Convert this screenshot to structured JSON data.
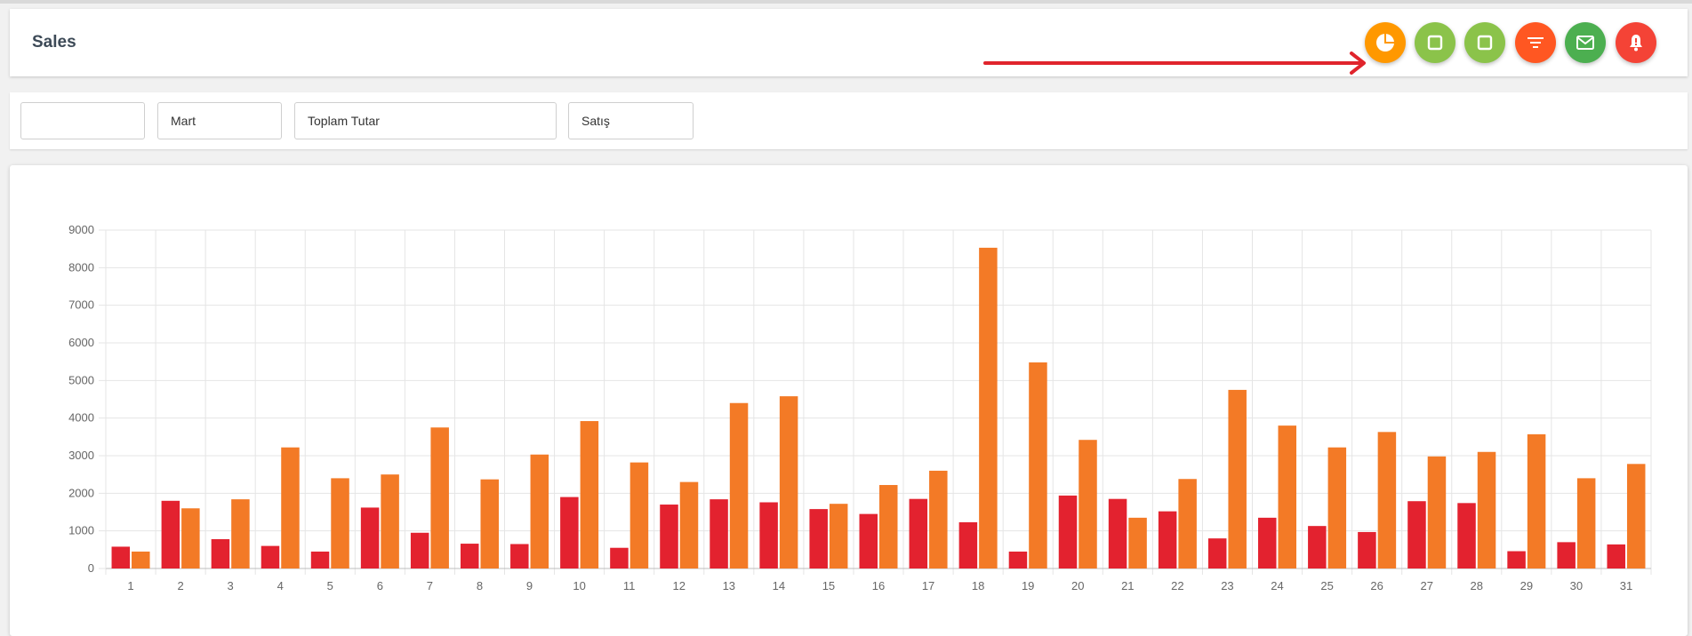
{
  "header": {
    "title": "Sales",
    "buttons": [
      {
        "name": "pie-chart-button",
        "icon": "pie-chart-icon",
        "color": "#ff9800"
      },
      {
        "name": "square-button-1",
        "icon": "square-icon",
        "color": "#8bc34a"
      },
      {
        "name": "square-button-2",
        "icon": "square-icon",
        "color": "#8bc34a"
      },
      {
        "name": "filter-button",
        "icon": "filter-icon",
        "color": "#ff5722"
      },
      {
        "name": "mail-button",
        "icon": "mail-icon",
        "color": "#4caf50"
      },
      {
        "name": "alert-button",
        "icon": "bell-alert-icon",
        "color": "#f44336"
      }
    ],
    "annotation_arrow_color": "#e0242c"
  },
  "filters": {
    "field1": "",
    "month": "Mart",
    "metric": "Toplam Tutar",
    "type": "Satış"
  },
  "chart_data": {
    "type": "bar",
    "categories": [
      "1",
      "2",
      "3",
      "4",
      "5",
      "6",
      "7",
      "8",
      "9",
      "10",
      "11",
      "12",
      "13",
      "14",
      "15",
      "16",
      "17",
      "18",
      "19",
      "20",
      "21",
      "22",
      "23",
      "24",
      "25",
      "26",
      "27",
      "28",
      "29",
      "30",
      "31"
    ],
    "series": [
      {
        "values": [
          580,
          1800,
          780,
          600,
          450,
          1620,
          950,
          660,
          650,
          1900,
          550,
          1700,
          1840,
          1760,
          1580,
          1450,
          1850,
          1230,
          450,
          1940,
          1850,
          1520,
          800,
          1350,
          1130,
          970,
          1790,
          1740,
          460,
          700,
          640
        ],
        "color": "#e3222f"
      },
      {
        "values": [
          450,
          1600,
          1840,
          3220,
          2400,
          2500,
          3750,
          2370,
          3030,
          3920,
          2820,
          2300,
          4400,
          4580,
          1720,
          2220,
          2600,
          8530,
          5480,
          3420,
          1350,
          2380,
          4750,
          3800,
          3220,
          3630,
          2980,
          3100,
          3570,
          2400,
          2780
        ],
        "color": "#f37a26"
      }
    ],
    "yticks": [
      0,
      1000,
      2000,
      3000,
      4000,
      5000,
      6000,
      7000,
      8000,
      9000
    ],
    "ylim": [
      0,
      9000
    ],
    "grid": true
  }
}
